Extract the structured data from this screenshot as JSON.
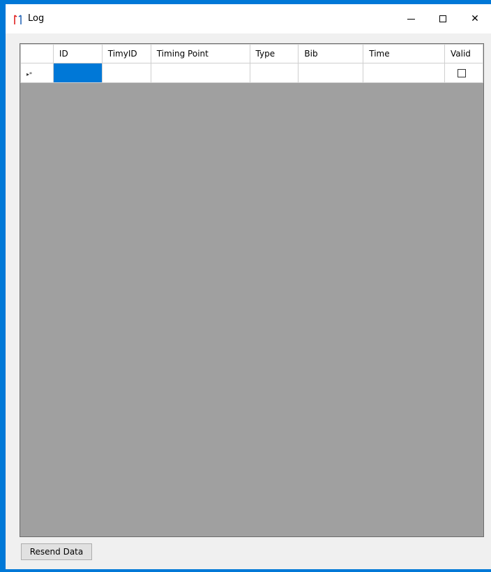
{
  "window": {
    "title": "Log",
    "accent_color": "#0078d7",
    "minimize_icon": "minimize-icon",
    "maximize_icon": "maximize-icon",
    "close_icon": "close-icon",
    "close_glyph": "✕"
  },
  "grid": {
    "columns": [
      "",
      "ID",
      "TimyID",
      "Timing Point",
      "Type",
      "Bib",
      "Time",
      "Valid"
    ],
    "new_row": {
      "indicator": "▸*",
      "id": "",
      "timy_id": "",
      "timing_point": "",
      "type": "",
      "bib": "",
      "time": "",
      "valid": false
    }
  },
  "footer": {
    "resend_label": "Resend Data"
  }
}
